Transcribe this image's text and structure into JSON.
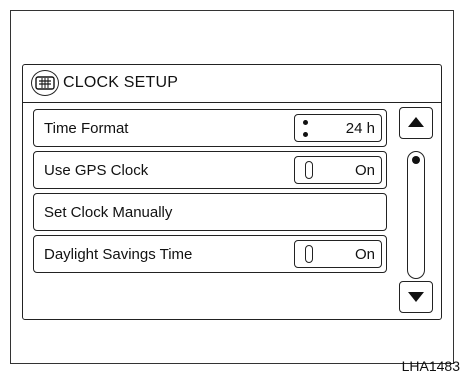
{
  "screen": {
    "title": "CLOCK SETUP",
    "header_icon": "clock-setup-icon"
  },
  "rows": [
    {
      "label": "Time Format",
      "value": "24 h",
      "control": "dots"
    },
    {
      "label": "Use GPS Clock",
      "value": "On",
      "control": "toggle"
    },
    {
      "label": "Set Clock Manually",
      "value": null,
      "control": "none"
    },
    {
      "label": "Daylight Savings Time",
      "value": "On",
      "control": "toggle"
    }
  ],
  "scrollbar": {
    "up_icon": "up-arrow-icon",
    "down_icon": "down-arrow-icon",
    "position_fraction": 0
  },
  "figure_code": "LHA1483"
}
